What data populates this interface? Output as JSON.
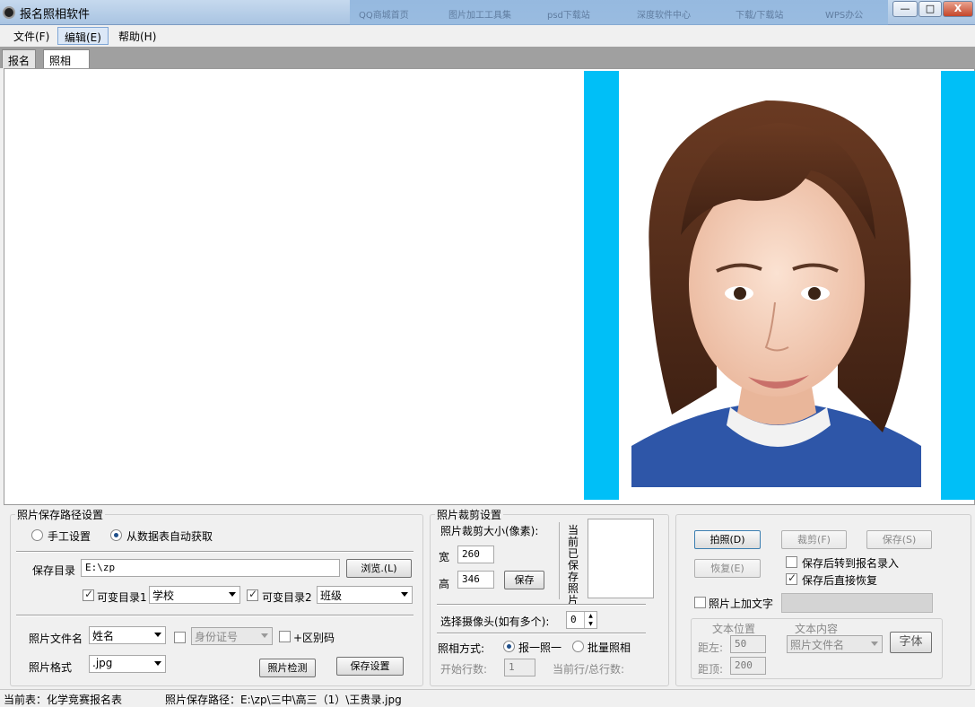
{
  "window": {
    "title": "报名照相软件",
    "taskbar_ghost": [
      "QQ商城首页",
      "图片加工工具集",
      "psd下载站",
      "深度软件中心",
      "下载/下载站",
      "WPS办公"
    ],
    "controls": {
      "minimize": "—",
      "maximize": "□",
      "close": "X"
    }
  },
  "menu": {
    "file": "文件(F)",
    "edit": "编辑(E)",
    "help": "帮助(H)"
  },
  "tabs": {
    "register": "报名",
    "photo": "照相"
  },
  "colors": {
    "accent_cyan": "#00bff7"
  },
  "path_group": {
    "title": "照片保存路径设置",
    "radio_manual": "手工设置",
    "radio_auto": "从数据表自动获取",
    "radio_selected": "auto",
    "save_dir_label": "保存目录",
    "save_dir_value": "E:\\zp",
    "browse_button": "浏览.(L)",
    "var_dir1_label": "可变目录1",
    "var_dir1_value": "学校",
    "var_dir2_label": "可变目录2",
    "var_dir2_value": "班级",
    "filename_label": "照片文件名",
    "filename_value": "姓名",
    "id_value": "身份证号",
    "distinguish_label": "+区别码",
    "format_label": "照片格式",
    "format_value": ".jpg",
    "check_button": "照片检测",
    "save_settings_button": "保存设置"
  },
  "crop_group": {
    "title": "照片裁剪设置",
    "size_label": "照片裁剪大小(像素):",
    "width_label": "宽",
    "width_value": "260",
    "height_label": "高",
    "height_value": "346",
    "save_button": "保存",
    "current_saved_label": "当前已保存照片",
    "camera_label": "选择摄像头(如有多个):",
    "camera_value": "0",
    "mode_label": "照相方式:",
    "mode_one": "报一照一",
    "mode_batch": "批量照相",
    "mode_selected": "one",
    "start_row_label": "开始行数:",
    "start_row_value": "1",
    "row_count_label": "当前行/总行数:"
  },
  "actions": {
    "take_photo": "拍照(D)",
    "crop": "裁剪(F)",
    "save": "保存(S)",
    "restore": "恢复(E)",
    "goto_register_label": "保存后转到报名录入",
    "goto_register_checked": false,
    "direct_restore_label": "保存后直接恢复",
    "direct_restore_checked": true,
    "add_text_label": "照片上加文字",
    "add_text_checked": false,
    "text_position_label": "文本位置",
    "text_content_label": "文本内容",
    "left_label": "距左:",
    "left_value": "50",
    "top_label": "距顶:",
    "top_value": "200",
    "content_value": "照片文件名",
    "font_button": "字体"
  },
  "status": {
    "current_table": "当前表：化学竞赛报名表",
    "photo_path": "照片保存路径：E:\\zp\\三中\\高三（1）\\王贵录.jpg"
  }
}
